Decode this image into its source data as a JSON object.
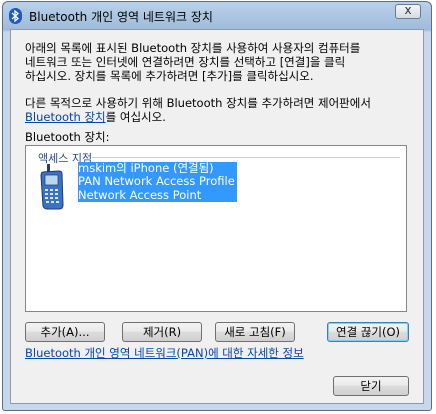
{
  "window": {
    "title": "Bluetooth 개인 영역 네트워크 장치",
    "close_label": "x"
  },
  "instructions": {
    "line1": "아래의 목록에 표시된 Bluetooth 장치를 사용하여 사용자의 컴퓨터를",
    "line2": "네트워크 또는 인터넷에 연결하려면 장치를 선택하고 [연결]을 클릭",
    "line3": "하십시오. 장치를 목록에 추가하려면 [추가]를 클릭하십시오."
  },
  "control_panel_note": {
    "line1": "다른 목적으로 사용하기 위해 Bluetooth 장치를 추가하려면 제어판에서",
    "link": "Bluetooth 장치",
    "line2_suffix": "를 여십시오."
  },
  "device_list": {
    "label": "Bluetooth 장치:",
    "group_header": "액세스 지점",
    "items": [
      {
        "name": "mskim의 iPhone (연결됨)",
        "profile": "PAN Network Access Profile",
        "type": "Network Access Point",
        "icon": "mobile-phone-icon",
        "selected": true
      }
    ]
  },
  "buttons": {
    "add": "추가(A)...",
    "remove": "제거(R)",
    "refresh": "새로 고침(F)",
    "disconnect": "연결 끊기(O)",
    "close": "닫기"
  },
  "pan_info_link": "Bluetooth 개인 영역 네트워크(PAN)에 대한 자세한 정보",
  "colors": {
    "selection": "#3399ff",
    "link": "#0645ad",
    "bluetooth": "#1f5bb8"
  }
}
